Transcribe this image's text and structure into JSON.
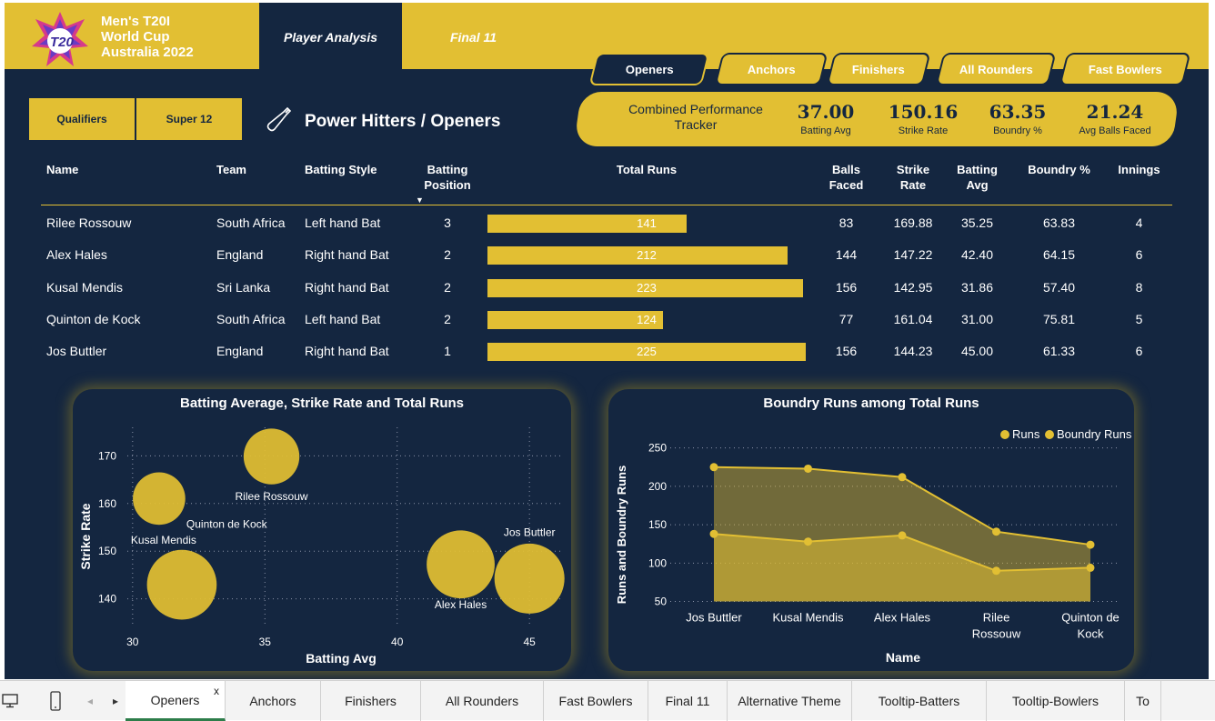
{
  "header": {
    "logo_title_lines": [
      "Men's T20I",
      "World Cup",
      "Australia 2022"
    ],
    "tabs": [
      "Player Analysis",
      "Final 11"
    ]
  },
  "role_tabs": [
    "Openers",
    "Anchors",
    "Finishers",
    "All Rounders",
    "Fast Bowlers"
  ],
  "stage_buttons": [
    "Qualifiers",
    "Super 12"
  ],
  "section_title": "Power Hitters / Openers",
  "tracker": {
    "title": "Combined Performance Tracker",
    "kpis": [
      {
        "value": "37.00",
        "label": "Batting Avg"
      },
      {
        "value": "150.16",
        "label": "Strike Rate"
      },
      {
        "value": "63.35",
        "label": "Boundry %"
      },
      {
        "value": "21.24",
        "label": "Avg Balls Faced"
      }
    ]
  },
  "table": {
    "headers": [
      "Name",
      "Team",
      "Batting Style",
      "Batting Position",
      "Total Runs",
      "Balls Faced",
      "Strike Rate",
      "Batting Avg",
      "Boundry %",
      "Innings"
    ],
    "sort_indicator": "▼",
    "rows": [
      {
        "name": "Rilee Rossouw",
        "team": "South Africa",
        "style": "Left hand Bat",
        "position": "3",
        "runs": "141",
        "balls": "83",
        "sr": "169.88",
        "avg": "35.25",
        "boundry": "63.83",
        "innings": "4"
      },
      {
        "name": "Alex Hales",
        "team": "England",
        "style": "Right hand Bat",
        "position": "2",
        "runs": "212",
        "balls": "144",
        "sr": "147.22",
        "avg": "42.40",
        "boundry": "64.15",
        "innings": "6"
      },
      {
        "name": "Kusal Mendis",
        "team": "Sri Lanka",
        "style": "Right hand Bat",
        "position": "2",
        "runs": "223",
        "balls": "156",
        "sr": "142.95",
        "avg": "31.86",
        "boundry": "57.40",
        "innings": "8"
      },
      {
        "name": "Quinton de Kock",
        "team": "South Africa",
        "style": "Left hand Bat",
        "position": "2",
        "runs": "124",
        "balls": "77",
        "sr": "161.04",
        "avg": "31.00",
        "boundry": "75.81",
        "innings": "5"
      },
      {
        "name": "Jos Buttler",
        "team": "England",
        "style": "Right hand Bat",
        "position": "1",
        "runs": "225",
        "balls": "156",
        "sr": "144.23",
        "avg": "45.00",
        "boundry": "61.33",
        "innings": "6"
      }
    ]
  },
  "colors": {
    "accent": "#e2bf33",
    "background": "#142640",
    "text": "#ffffff"
  },
  "chart_data": [
    {
      "type": "scatter",
      "title": "Batting Average, Strike Rate and Total Runs",
      "xlabel": "Batting Avg",
      "ylabel": "Strike Rate",
      "xlim": [
        29.8,
        46.3
      ],
      "ylim": [
        134,
        176
      ],
      "xticks": [
        "30",
        "35",
        "40",
        "45"
      ],
      "yticks": [
        "140",
        "150",
        "160",
        "170"
      ],
      "points": [
        {
          "label": "Rilee Rossouw",
          "x": 35.25,
          "y": 169.88,
          "size": 141
        },
        {
          "label": "Alex Hales",
          "x": 42.4,
          "y": 147.22,
          "size": 212
        },
        {
          "label": "Kusal Mendis",
          "x": 31.86,
          "y": 142.95,
          "size": 223
        },
        {
          "label": "Quinton de Kock",
          "x": 31.0,
          "y": 161.04,
          "size": 124
        },
        {
          "label": "Jos Buttler",
          "x": 45.0,
          "y": 144.23,
          "size": 225
        }
      ]
    },
    {
      "type": "area",
      "title": "Boundry Runs among Total Runs",
      "xlabel": "Name",
      "ylabel": "Runs and Boundry Runs",
      "ylim": [
        40,
        265
      ],
      "yticks": [
        "50",
        "100",
        "150",
        "200",
        "250"
      ],
      "categories": [
        "Jos Buttler",
        "Kusal Mendis",
        "Alex Hales",
        "Rilee Rossouw",
        "Quinton de Kock"
      ],
      "legend": "top-right",
      "series": [
        {
          "name": "Runs",
          "values": [
            225,
            223,
            212,
            141,
            124
          ]
        },
        {
          "name": "Boundry Runs",
          "values": [
            138,
            128,
            136,
            90,
            94
          ]
        }
      ]
    }
  ],
  "sheet_tabs": [
    "Openers",
    "Anchors",
    "Finishers",
    "All Rounders",
    "Fast Bowlers",
    "Final 11",
    "Alternative Theme",
    "Tooltip-Batters",
    "Tooltip-Bowlers",
    "To"
  ],
  "sheetbar_icons": {
    "desktop": "desktop-icon",
    "phone": "phone-icon",
    "prev": "◂",
    "next": "▸",
    "close": "x"
  }
}
